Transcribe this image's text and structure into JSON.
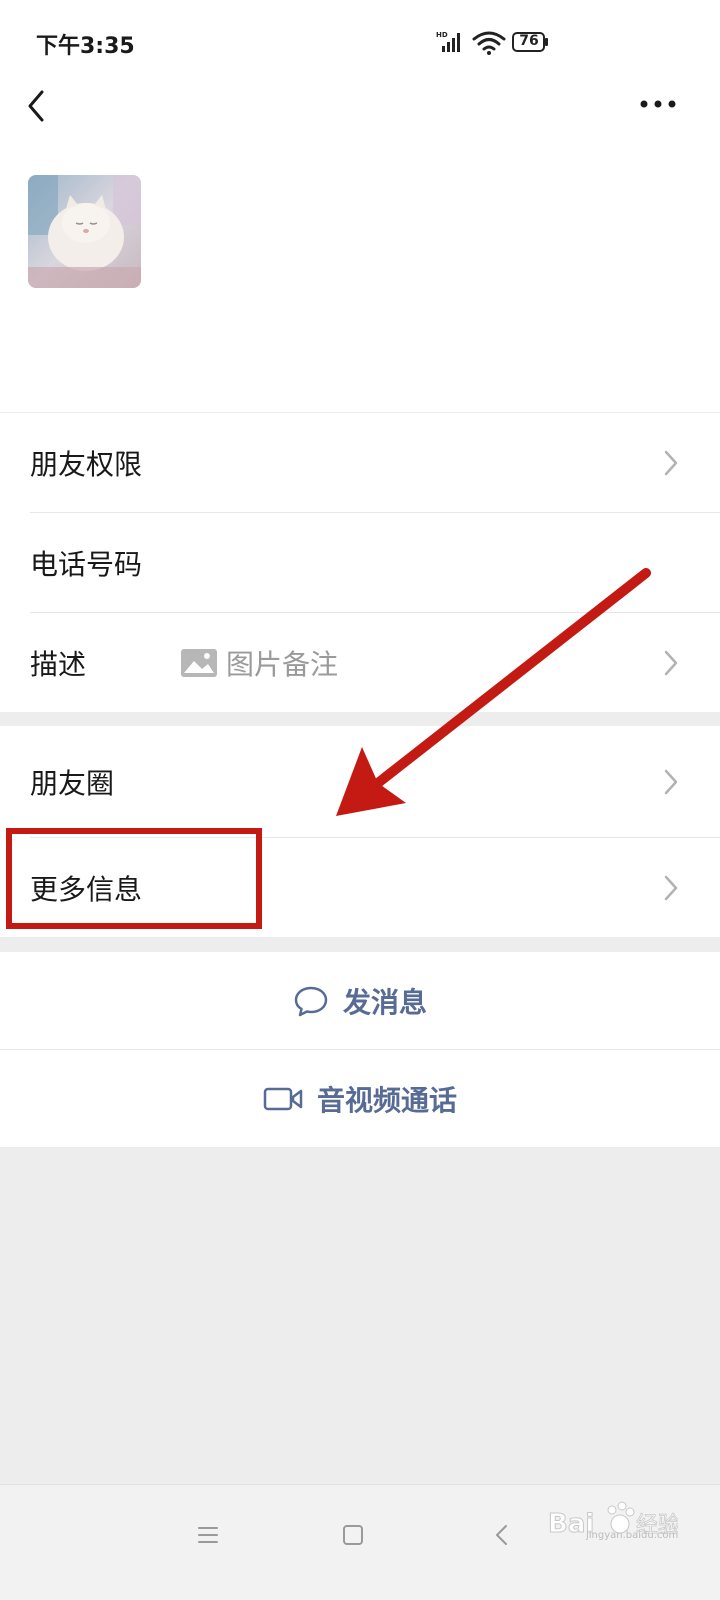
{
  "status_bar": {
    "time": "下午3:35",
    "battery": "76",
    "network": "HD"
  },
  "nav": {
    "back_icon": "chevron-left-icon",
    "more_icon": "more-dots-icon"
  },
  "group1": {
    "rows": [
      {
        "label": "朋友权限"
      },
      {
        "label": "电话号码"
      },
      {
        "label": "描述",
        "hint": "图片备注"
      }
    ]
  },
  "group2": {
    "rows": [
      {
        "label": "朋友圈"
      },
      {
        "label": "更多信息"
      }
    ]
  },
  "actions": {
    "send_message": "发消息",
    "call": "音视频通话"
  },
  "watermark": {
    "brand": "Bai",
    "suffix": "经验",
    "url": "jingyan.baidu.com"
  },
  "colors": {
    "link": "#576b95",
    "annotation": "#c41a14"
  }
}
